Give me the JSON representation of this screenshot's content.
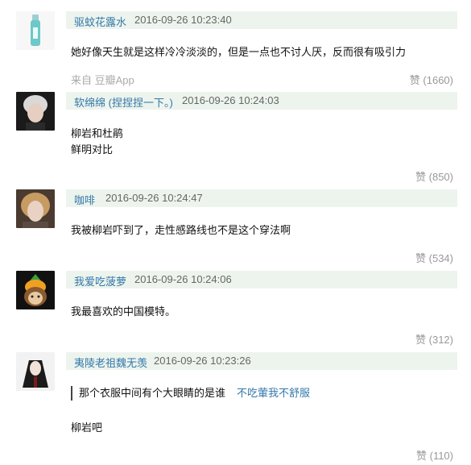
{
  "comments": [
    {
      "username": "驱蚊花露水",
      "timestamp": "2016-09-26 10:23:40",
      "lines": [
        "她好像天生就是这样冷冷淡淡的，但是一点也不讨人厌，反而很有吸引力"
      ],
      "source": "来自 豆瓣App",
      "likes": "赞 (1660)",
      "avatar_icon": "spray-bottle-icon"
    },
    {
      "username": "软绵绵 (捏捏捏一下。)",
      "timestamp": "2016-09-26 10:24:03",
      "lines": [
        "柳岩和杜鹃",
        "鲜明对比"
      ],
      "likes": "赞 (850)",
      "avatar_icon": "person-portrait-icon"
    },
    {
      "username": "咖啡",
      "timestamp": "2016-09-26 10:24:47",
      "lines": [
        "我被柳岩吓到了，走性感路线也不是这个穿法啊"
      ],
      "likes": "赞 (534)",
      "avatar_icon": "person-portrait-icon"
    },
    {
      "username": "我爱吃菠萝",
      "timestamp": "2016-09-26 10:24:06",
      "lines": [
        "我最喜欢的中国模特。"
      ],
      "likes": "赞 (312)",
      "avatar_icon": "monkey-doll-icon"
    },
    {
      "username": "夷陵老祖魏无羡",
      "timestamp": "2016-09-26 10:23:26",
      "quote_text": "那个衣服中间有个大眼睛的是谁",
      "quote_author": "不吃葷我不舒服",
      "lines": [
        "柳岩吧"
      ],
      "likes": "赞 (110)",
      "avatar_icon": "anime-character-icon"
    }
  ]
}
